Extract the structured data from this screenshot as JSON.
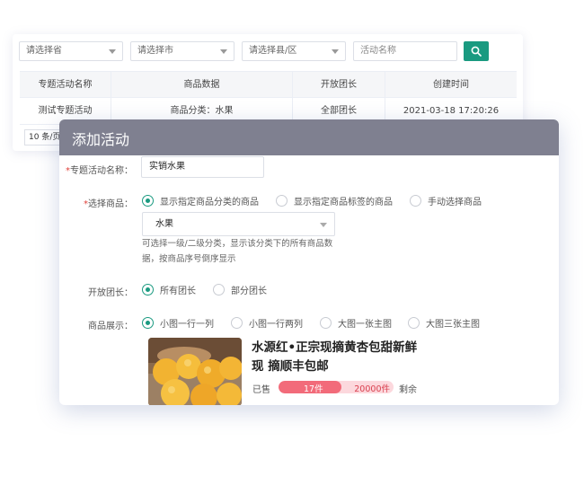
{
  "filters": {
    "province": "请选择省",
    "city": "请选择市",
    "county": "请选择县/区",
    "activity_name_placeholder": "活动名称"
  },
  "table": {
    "headers": [
      "专题活动名称",
      "商品数据",
      "开放团长",
      "创建时间"
    ],
    "rows": [
      [
        "测试专题活动",
        "商品分类：水果",
        "全部团长",
        "2021-03-18 17:20:26"
      ]
    ],
    "page_size": "10 条/页"
  },
  "dialog": {
    "title": "添加活动",
    "activity_name": {
      "required_mark": "*",
      "label": "专题活动名称：",
      "value": "实销水果"
    },
    "select_goods": {
      "required_mark": "*",
      "label": "选择商品：",
      "options": [
        "显示指定商品分类的商品",
        "显示指定商品标签的商品",
        "手动选择商品"
      ],
      "selected_index": 0,
      "category_value": "水果",
      "hint_line1": "可选择一级/二级分类，显示该分类下的所有商品数",
      "hint_line2": "据，按商品序号倒序显示"
    },
    "open_leader": {
      "label": "开放团长：",
      "options": [
        "所有团长",
        "部分团长"
      ],
      "selected_index": 0
    },
    "goods_display": {
      "label": "商品展示：",
      "options": [
        "小图一行一列",
        "小图一行两列",
        "大图一张主图",
        "大图三张主图"
      ],
      "selected_index": 0
    },
    "product": {
      "title_line1": "水源红•正宗现摘黄杏包甜新鲜",
      "title_line2": "现 摘顺丰包邮",
      "sold_label": "已售",
      "sold_count": "17件",
      "total_count": "20000件",
      "remain_label": "剩余",
      "sold_fraction": 0.55
    }
  },
  "colors": {
    "accent": "#1a9a80",
    "dialog_header": "#7f8090",
    "progress_fill": "#f26b7a",
    "progress_track": "#fcd8dd",
    "required": "#e0403a"
  }
}
